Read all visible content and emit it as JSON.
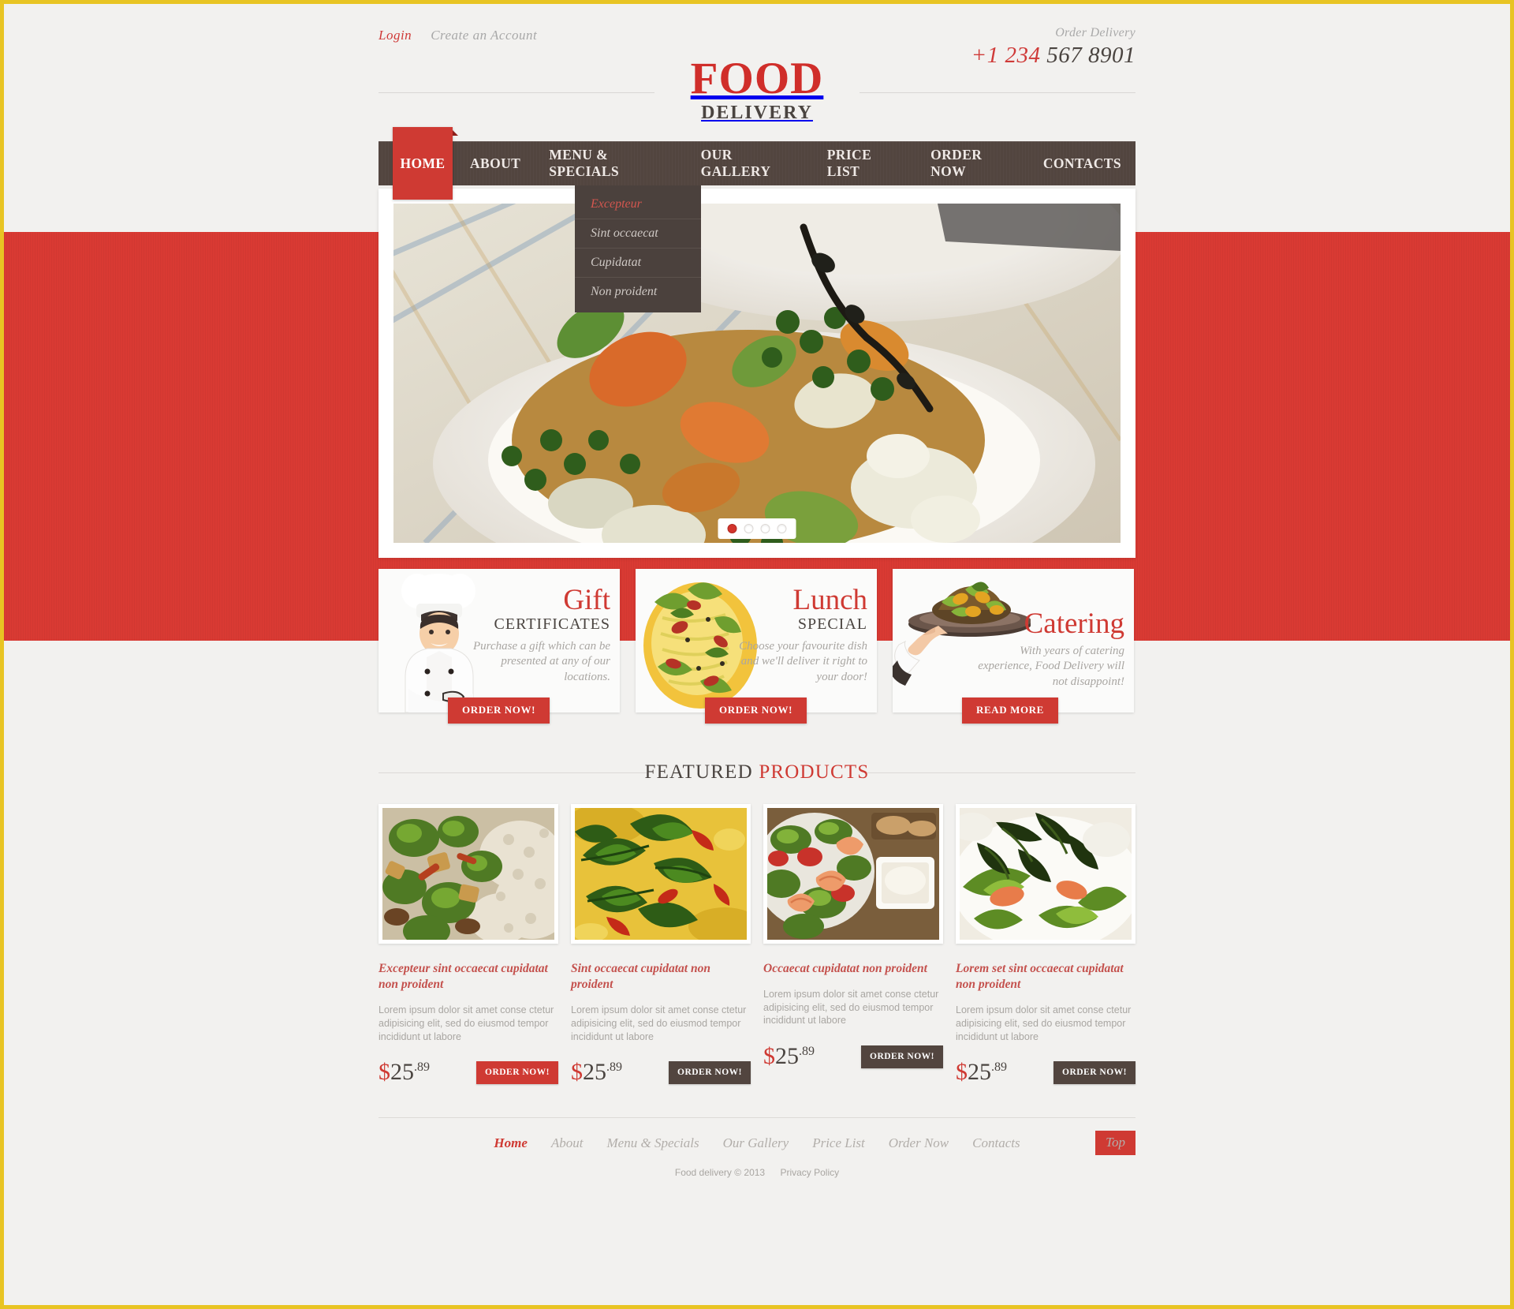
{
  "top": {
    "login_label": "Login",
    "create_account_label": "Create an Account",
    "order_delivery_label": "Order Delivery",
    "phone_prefix": "+1 234 ",
    "phone_rest": "567 8901"
  },
  "logo": {
    "main": "FOOD",
    "sub": "DELIVERY"
  },
  "nav": {
    "home": "HOME",
    "items": [
      {
        "label": "ABOUT"
      },
      {
        "label": "MENU & SPECIALS"
      },
      {
        "label": "OUR GALLERY"
      },
      {
        "label": "PRICE LIST"
      },
      {
        "label": "ORDER NOW"
      },
      {
        "label": "CONTACTS"
      }
    ],
    "dropdown": [
      {
        "label": "Excepteur",
        "active": true
      },
      {
        "label": "Sint occaecat",
        "active": false
      },
      {
        "label": "Cupidatat",
        "active": false
      },
      {
        "label": "Non proident",
        "active": false
      }
    ]
  },
  "slider": {
    "dots": 4,
    "active_dot": 1
  },
  "promos": [
    {
      "title": "Gift",
      "subtitle": "CERTIFICATES",
      "desc": "Purchase a gift which can be presented at any of our locations.",
      "button": "ORDER NOW!",
      "art": "chef-icon"
    },
    {
      "title": "Lunch",
      "subtitle": "SPECIAL",
      "desc": "Choose your favourite dish and we'll deliver it right to your door!",
      "button": "ORDER NOW!",
      "art": "salad-icon"
    },
    {
      "title": "Catering",
      "subtitle": "",
      "desc": "With years of catering experience, Food Delivery will not disappoint!",
      "button": "READ MORE",
      "art": "waiter-tray-icon"
    }
  ],
  "featured": {
    "heading_plain": "FEATURED ",
    "heading_accent": "PRODUCTS",
    "products": [
      {
        "title": "Excepteur sint occaecat cupidatat non proident",
        "desc": "Lorem ipsum dolor sit amet conse ctetur adipisicing elit, sed do eiusmod tempor incididunt ut labore",
        "currency": "$",
        "price": "25",
        "cents": ".89",
        "button": "ORDER NOW!",
        "button_hot": true
      },
      {
        "title": "Sint occaecat cupidatat non proident",
        "desc": "Lorem ipsum dolor sit amet conse ctetur adipisicing elit, sed do eiusmod tempor incididunt ut labore",
        "currency": "$",
        "price": "25",
        "cents": ".89",
        "button": "ORDER NOW!",
        "button_hot": false
      },
      {
        "title": "Occaecat cupidatat non proident",
        "desc": "Lorem ipsum dolor sit amet conse ctetur adipisicing elit, sed do eiusmod tempor incididunt ut labore",
        "currency": "$",
        "price": "25",
        "cents": ".89",
        "button": "ORDER NOW!",
        "button_hot": false
      },
      {
        "title": "Lorem set sint occaecat cupidatat non proident",
        "desc": "Lorem ipsum dolor sit amet conse ctetur adipisicing elit, sed do eiusmod tempor incididunt ut labore",
        "currency": "$",
        "price": "25",
        "cents": ".89",
        "button": "ORDER NOW!",
        "button_hot": false
      }
    ]
  },
  "footer": {
    "nav": [
      {
        "label": "Home",
        "active": true
      },
      {
        "label": "About",
        "active": false
      },
      {
        "label": "Menu & Specials",
        "active": false
      },
      {
        "label": "Our Gallery",
        "active": false
      },
      {
        "label": "Price List",
        "active": false
      },
      {
        "label": "Order Now",
        "active": false
      },
      {
        "label": "Contacts",
        "active": false
      }
    ],
    "top_button": "Top",
    "copyright": "Food delivery © 2013",
    "privacy": "Privacy Policy"
  },
  "colors": {
    "accent_red": "#cf3a33",
    "dark_brown": "#52453f",
    "muted_gray": "#a9a6a2",
    "border_yellow": "#e8c423"
  }
}
